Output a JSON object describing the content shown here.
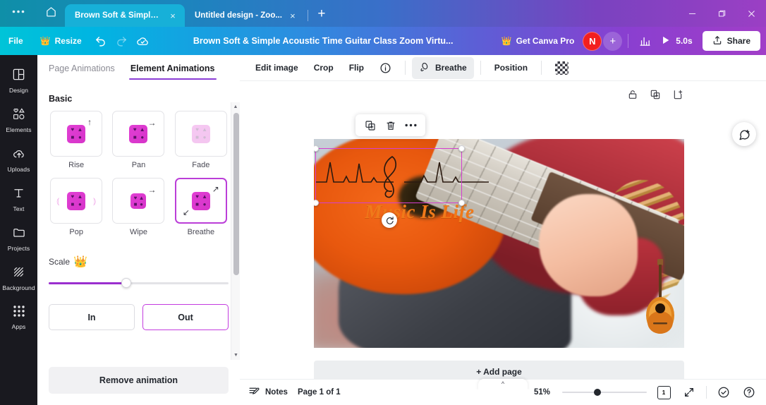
{
  "browser": {
    "menu_icon": "overflow-dots-icon",
    "home_icon": "home-icon",
    "tabs": [
      {
        "title": "Brown Soft & Simple A...",
        "close": "×",
        "active": true
      },
      {
        "title": "Untitled design - Zoo...",
        "close": "×",
        "active": false
      }
    ],
    "new_tab": "+",
    "window": {
      "minimize": "—",
      "maximize": "❐",
      "close": "✕"
    }
  },
  "header": {
    "file_label": "File",
    "resize_label": "Resize",
    "crown": "👑",
    "undo_icon": "undo-icon",
    "redo_icon": "redo-icon",
    "cloud_icon": "cloud-saved-icon",
    "title": "Brown Soft & Simple Acoustic Time Guitar Class Zoom Virtu...",
    "pro_label": "Get Canva Pro",
    "avatar_initial": "N",
    "add_member": "+",
    "insights_icon": "bar-chart-icon",
    "play_icon": "play-icon",
    "duration": "5.0s",
    "share_label": "Share",
    "share_icon": "upload-icon"
  },
  "rail": {
    "items": [
      {
        "label": "Design",
        "icon": "layout-icon"
      },
      {
        "label": "Elements",
        "icon": "shapes-icon"
      },
      {
        "label": "Uploads",
        "icon": "upload-cloud-icon"
      },
      {
        "label": "Text",
        "icon": "text-icon"
      },
      {
        "label": "Projects",
        "icon": "folder-icon"
      },
      {
        "label": "Background",
        "icon": "hatch-icon"
      },
      {
        "label": "Apps",
        "icon": "grid-dots-icon"
      }
    ]
  },
  "panel": {
    "tabs": [
      {
        "label": "Page Animations",
        "active": false
      },
      {
        "label": "Element Animations",
        "active": true
      }
    ],
    "section_title": "Basic",
    "animations": [
      {
        "label": "Rise",
        "arrow": "↑",
        "arrow_class": "up",
        "selected": false,
        "faded": false,
        "waves": false
      },
      {
        "label": "Pan",
        "arrow": "→",
        "arrow_class": "right",
        "selected": false,
        "faded": false,
        "waves": false
      },
      {
        "label": "Fade",
        "arrow": "",
        "arrow_class": "",
        "selected": false,
        "faded": true,
        "waves": false
      },
      {
        "label": "Pop",
        "arrow": "",
        "arrow_class": "",
        "selected": false,
        "faded": false,
        "waves": true
      },
      {
        "label": "Wipe",
        "arrow": "→",
        "arrow_class": "right",
        "selected": false,
        "faded": false,
        "waves": false
      },
      {
        "label": "Breathe",
        "arrow": "↗",
        "arrow_class": "ne",
        "arrow2": "↙",
        "selected": true,
        "faded": false,
        "waves": false
      }
    ],
    "scale_label": "Scale",
    "scale_crown": "👑",
    "scale_percent": 43,
    "direction": {
      "in_label": "In",
      "out_label": "Out",
      "selected": "Out"
    },
    "remove_label": "Remove animation",
    "accent": "#8b3dd6",
    "selected_border": "#bb3ed8"
  },
  "toolbar": {
    "edit_image": "Edit image",
    "crop": "Crop",
    "flip": "Flip",
    "info_icon": "info-icon",
    "animate_label": "Breathe",
    "animate_icon": "animation-icon",
    "position": "Position",
    "transparency_icon": "transparency-checker-icon"
  },
  "canvas": {
    "float_tools": [
      {
        "icon": "duplicate-icon"
      },
      {
        "icon": "trash-icon"
      },
      {
        "icon": "more-dots-icon"
      }
    ],
    "page_icons": [
      {
        "icon": "lock-icon"
      },
      {
        "icon": "duplicate-page-icon"
      },
      {
        "icon": "add-page-icon"
      }
    ],
    "design_text": "Music Is Life",
    "design_text_color": "#f07a1a",
    "selection_color": "#d43fd0",
    "rotate_icon": "rotate-icon",
    "comment_icon": "comment-add-icon",
    "add_page_label": "+ Add page"
  },
  "status": {
    "notes_icon": "notes-icon",
    "notes_label": "Notes",
    "page_label": "Page 1 of 1",
    "zoom_percent": "51%",
    "zoom_value": 42,
    "page_count": "1",
    "fullscreen_icon": "expand-icon",
    "check_icon": "check-circle-icon",
    "help_icon": "help-circle-icon"
  }
}
